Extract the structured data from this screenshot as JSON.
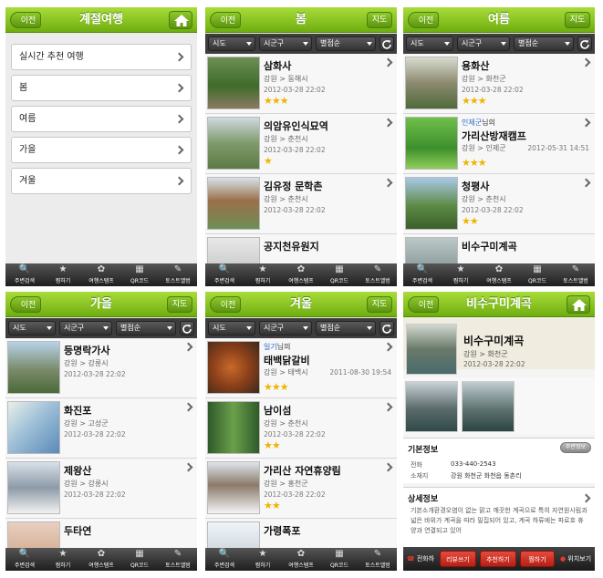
{
  "common": {
    "back_label": "이전",
    "map_label": "지도",
    "filters": [
      "시도",
      "시군구",
      "별점순"
    ],
    "tabs": [
      "주변검색",
      "찜하기",
      "여행스탬프",
      "QR코드",
      "토스트앨범"
    ]
  },
  "screens": {
    "menu": {
      "title": "계절여행",
      "items": [
        "실시간 추천 여행",
        "봄",
        "여름",
        "가을",
        "겨울"
      ]
    },
    "spring": {
      "title": "봄",
      "items": [
        {
          "title": "삼화사",
          "loc": "강원 > 동해시",
          "date": "2012-03-28 22:02",
          "stars": 3
        },
        {
          "title": "의암유인식묘역",
          "loc": "강원 > 춘천시",
          "date": "2012-03-28 22:02",
          "stars": 1
        },
        {
          "title": "김유정 문학촌",
          "loc": "강원 > 춘천시",
          "date": "2012-03-28 22:02",
          "stars": 0
        },
        {
          "title": "공지천유원지",
          "loc": "",
          "date": "",
          "stars": 0
        }
      ]
    },
    "summer": {
      "title": "여름",
      "items": [
        {
          "title": "용화산",
          "loc": "강원 > 화천군",
          "date": "2012-03-28 22:02",
          "stars": 3
        },
        {
          "title": "가리산방재캠프",
          "user": "인제군",
          "user_suffix": "님의",
          "loc": "강원 > 인제군",
          "date": "2012-05-31 14:51",
          "stars": 3
        },
        {
          "title": "청평사",
          "loc": "강원 > 춘천시",
          "date": "2012-03-28 22:02",
          "stars": 2
        },
        {
          "title": "비수구미계곡",
          "loc": "",
          "date": "",
          "stars": 0
        }
      ]
    },
    "autumn": {
      "title": "가을",
      "items": [
        {
          "title": "등명락가사",
          "loc": "강원 > 강릉시",
          "date": "2012-03-28 22:02",
          "stars": 0
        },
        {
          "title": "화진포",
          "loc": "강원 > 고성군",
          "date": "2012-03-28 22:02",
          "stars": 0
        },
        {
          "title": "제왕산",
          "loc": "강원 > 강릉시",
          "date": "2012-03-28 22:02",
          "stars": 0
        },
        {
          "title": "두타연",
          "loc": "",
          "date": "",
          "stars": 0
        }
      ]
    },
    "winter": {
      "title": "겨울",
      "items": [
        {
          "title": "태백닭갈비",
          "user": "일기",
          "user_suffix": "님의",
          "loc": "강원 > 태백시",
          "date": "2011-08-30 19:54",
          "stars": 3
        },
        {
          "title": "남이섬",
          "loc": "강원 > 춘천시",
          "date": "2012-03-28 22:02",
          "stars": 2
        },
        {
          "title": "가리산 자연휴양림",
          "loc": "강원 > 홍천군",
          "date": "2012-03-28 22:02",
          "stars": 2
        },
        {
          "title": "가령폭포",
          "loc": "",
          "date": "",
          "stars": 0
        }
      ]
    },
    "detail": {
      "title": "비수구미계곡",
      "name": "비수구미계곡",
      "loc": "강원 > 화천군",
      "date": "2012-03-28 22:02",
      "basic_title": "기본정보",
      "nearby_button": "주변정보",
      "phone_label": "전화",
      "phone": "033-440-2543",
      "address_label": "소재지",
      "address": "강원 화천군 화천읍 동촌리",
      "detail_title": "상세정보",
      "description": "기본소개환경오염이 없는 맑고 깨끗한 계곡으로 특히 자연원시림과 넓은 바위가 계곡을 따라 밀집되어 있고, 계곡 하류에는 파로호 휴양과 연결되고 있어",
      "actions": [
        "전화하기",
        "리뷰쓰기",
        "추천하기",
        "찜하기",
        "위치보기"
      ]
    }
  }
}
